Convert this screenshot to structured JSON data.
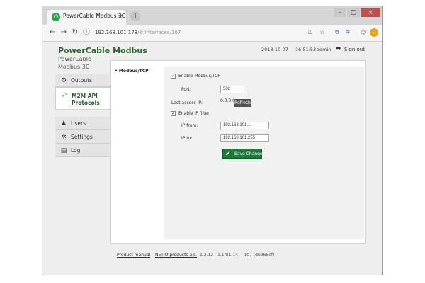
{
  "browser": {
    "tab_title": "PowerCable Modbus 3C",
    "tab_close": "×",
    "new_tab": "+",
    "url_host": "192.168.101.178",
    "url_path": "/#/interfaces/107",
    "controls": {
      "minimize": "–",
      "maximize": "□",
      "close": "×"
    },
    "nav": {
      "back": "←",
      "forward": "→",
      "reload": "↻",
      "info": "ⓘ"
    },
    "icons": {
      "key": "⚿",
      "star": "☆",
      "ext1": "⧉",
      "ext2": "≋",
      "account": "☺",
      "menu": "⋮"
    }
  },
  "header": {
    "product": "PowerCable Modbus",
    "subtitle": "PowerCable Modbus 3C",
    "date": "2018-10-07",
    "time": "16:51:53",
    "user": "admin",
    "signout": "Sign out",
    "signout_icon": "➦"
  },
  "sidebar": {
    "items": [
      {
        "label": "Outputs",
        "icon": "⚙"
      },
      {
        "label": "M2M API Protocols",
        "icon": "∘°"
      },
      {
        "label": "Users",
        "icon": "♟"
      },
      {
        "label": "Settings",
        "icon": "✲"
      },
      {
        "label": "Log",
        "icon": "▤"
      }
    ]
  },
  "content": {
    "subnav": "• Modbus/TCP",
    "enable_modbus": "Enable Modbus/TCP",
    "port_label": "Port:",
    "port_value": "502",
    "last_access_label": "Last access IP:",
    "last_access_value": "0.0.0.0",
    "refresh": "Refresh",
    "enable_ip_filter": "Enable IP filter",
    "ip_from_label": "IP from:",
    "ip_from_value": "192.168.101.1",
    "ip_to_label": "IP to:",
    "ip_to_value": "192.168.101.255",
    "save": "Save Changes",
    "check": "✓",
    "save_icon": "✔"
  },
  "footer": {
    "manual": "Product manual",
    "company": "NETIO products a.s.",
    "version": "1.2.12 - 1.14(1.14) - 107 (db965ef)"
  },
  "colors": {
    "accent": "#2a6a2a",
    "button": "#1e7a3a"
  }
}
